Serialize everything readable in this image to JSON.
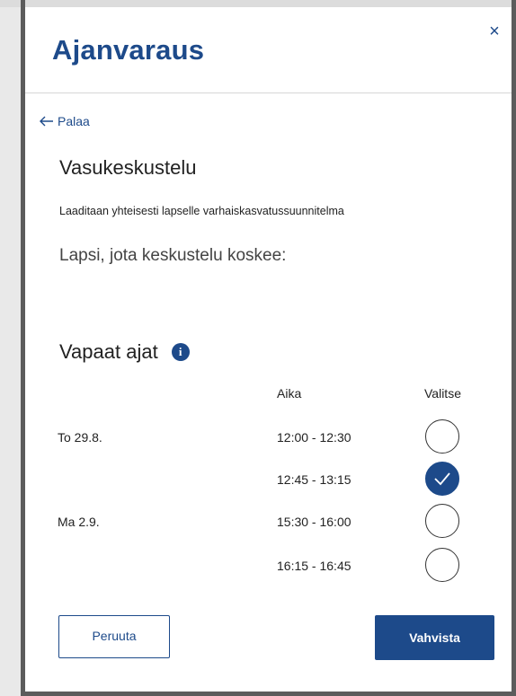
{
  "modal": {
    "title": "Ajanvaraus",
    "close_glyph": "×",
    "back_label": "Palaa",
    "event_title": "Vasukeskustelu",
    "event_description": "Laaditaan yhteisesti lapselle varhaiskasvatussuunnitelma",
    "child_label": "Lapsi, jota keskustelu koskee:",
    "slots_title": "Vapaat ajat",
    "info_glyph": "i",
    "columns": {
      "time": "Aika",
      "select": "Valitse"
    },
    "slots": [
      {
        "date": "To 29.8.",
        "time": "12:00 - 12:30",
        "selected": false
      },
      {
        "date": "",
        "time": "12:45 - 13:15",
        "selected": true
      },
      {
        "date": "Ma 2.9.",
        "time": "15:30 - 16:00",
        "selected": false
      },
      {
        "date": "",
        "time": "16:15 - 16:45",
        "selected": false
      }
    ],
    "buttons": {
      "cancel": "Peruuta",
      "confirm": "Vahvista"
    }
  },
  "colors": {
    "primary": "#1d4a8a",
    "frame": "#5c5c5c"
  },
  "icons": {
    "back": "arrow-left-icon",
    "close": "close-icon",
    "info": "info-icon",
    "check": "check-icon"
  }
}
